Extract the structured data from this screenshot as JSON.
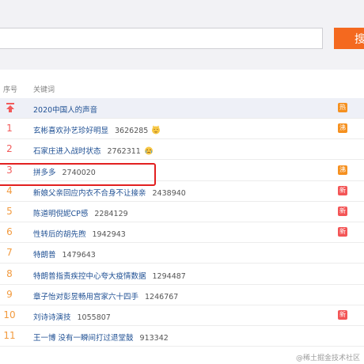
{
  "search": {
    "value": "",
    "button_label": "搜"
  },
  "header": {
    "rank_label": "序号",
    "keyword_label": "关键词"
  },
  "colors": {
    "red": "#f25a5a",
    "orange": "#f29a3e",
    "hot_badge": "#f5901f",
    "new_badge": "#f35556",
    "accent": "#f4691f"
  },
  "rows": [
    {
      "rank": "",
      "title": "2020中国人的声音",
      "count": "",
      "emoji": "",
      "badge": "热",
      "pinned": true
    },
    {
      "rank": "1",
      "title": "玄彬喜欢孙艺珍好明显",
      "count": "3626285",
      "emoji": "cat-face-icon",
      "badge": "沸"
    },
    {
      "rank": "2",
      "title": "石家庄进入战时状态",
      "count": "2762311",
      "emoji": "crying-face-icon",
      "badge": ""
    },
    {
      "rank": "3",
      "title": "拼多多",
      "count": "2740020",
      "emoji": "",
      "badge": "沸"
    },
    {
      "rank": "4",
      "title": "新娘父亲回应内衣不合身不让接亲",
      "count": "2438940",
      "emoji": "",
      "badge": "新"
    },
    {
      "rank": "5",
      "title": "陈道明倪妮CP感",
      "count": "2284129",
      "emoji": "",
      "badge": "新"
    },
    {
      "rank": "6",
      "title": "性转后的胡先煦",
      "count": "1942943",
      "emoji": "",
      "badge": "新"
    },
    {
      "rank": "7",
      "title": "特朗普",
      "count": "1479643",
      "emoji": "",
      "badge": ""
    },
    {
      "rank": "8",
      "title": "特朗普指责疾控中心夸大疫情数据",
      "count": "1294487",
      "emoji": "",
      "badge": ""
    },
    {
      "rank": "9",
      "title": "章子怡对彭昱畅用宫家六十四手",
      "count": "1246767",
      "emoji": "",
      "badge": ""
    },
    {
      "rank": "10",
      "title": "刘诗诗演技",
      "count": "1055807",
      "emoji": "",
      "badge": "新"
    },
    {
      "rank": "11",
      "title": "王一博 没有一瞬间打过退堂鼓",
      "count": "913342",
      "emoji": "",
      "badge": ""
    }
  ],
  "watermark": "@稀土掘金技术社区"
}
